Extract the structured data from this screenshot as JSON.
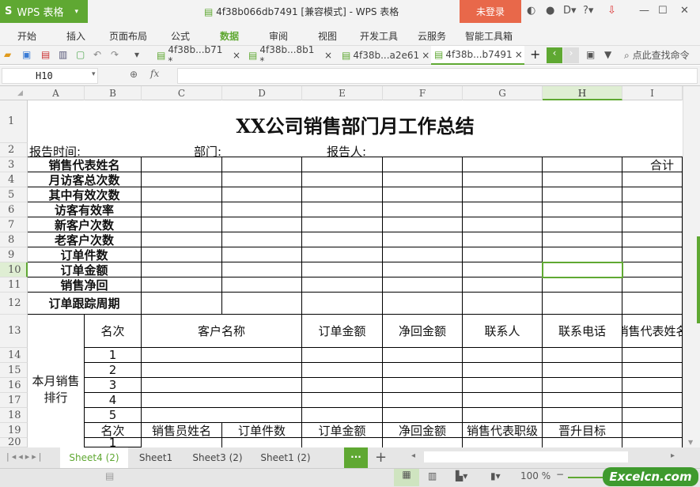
{
  "app": {
    "name": "WPS 表格",
    "title": "4f38b066db7491 [兼容模式] - WPS 表格",
    "login": "未登录"
  },
  "menu": [
    "开始",
    "插入",
    "页面布局",
    "公式",
    "数据",
    "审阅",
    "视图",
    "开发工具",
    "云服务",
    "智能工具箱"
  ],
  "active_menu": "数据",
  "doc_tabs": [
    "4f38b...b71 *",
    "4f38b...8b1 *",
    "4f38b...a2e61",
    "4f38b...b7491"
  ],
  "search_cmd": "点此查找命令",
  "formula_bar": {
    "name_box": "H10",
    "fx": "fx",
    "value": ""
  },
  "columns": [
    "A",
    "B",
    "C",
    "D",
    "E",
    "F",
    "G",
    "H",
    "I"
  ],
  "rows": [
    "1",
    "2",
    "3",
    "4",
    "5",
    "6",
    "7",
    "8",
    "9",
    "10",
    "11",
    "12",
    "13",
    "14",
    "15",
    "16",
    "17",
    "18",
    "19",
    "20"
  ],
  "sheet": {
    "title": "XX公司销售部门月工作总结",
    "report_time": "报告时间:",
    "dept": "部门:",
    "reporter": "报告人:",
    "total": "合计",
    "metrics": [
      "销售代表姓名",
      "月访客总次数",
      "其中有效次数",
      "访客有效率",
      "新客户次数",
      "老客户次数",
      "订单件数",
      "订单金额",
      "销售净回",
      "订单跟踪周期"
    ],
    "ranking_label": "本月销售排行",
    "header1": [
      "名次",
      "客户名称",
      "订单金额",
      "净回金额",
      "联系人",
      "联系电话",
      "销售代表姓名"
    ],
    "ranks": [
      "1",
      "2",
      "3",
      "4",
      "5"
    ],
    "header2": [
      "名次",
      "销售员姓名",
      "订单件数",
      "订单金额",
      "净回金额",
      "销售代表职级",
      "晋升目标"
    ],
    "row20_rank": "1"
  },
  "sheet_tabs": [
    "Sheet4 (2)",
    "Sheet1",
    "Sheet3 (2)",
    "Sheet1 (2)"
  ],
  "active_sheet": "Sheet4 (2)",
  "zoom": "100 %",
  "watermark": "Excelcn.com",
  "accent": "#5fa832"
}
